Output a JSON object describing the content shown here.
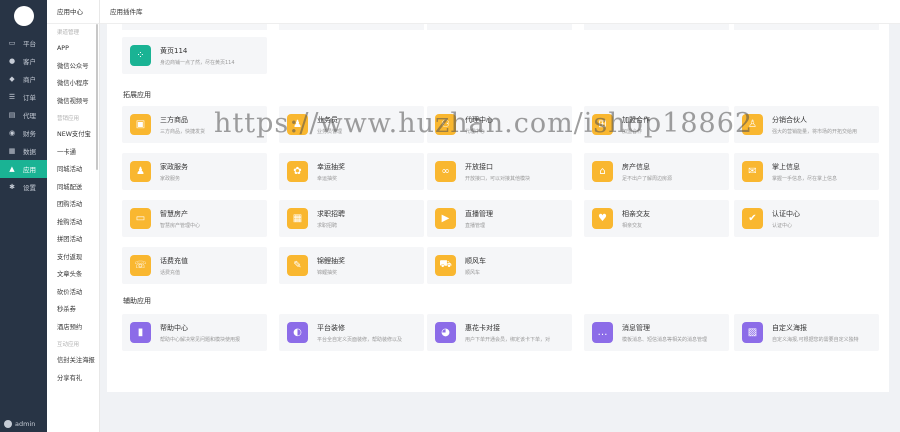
{
  "rail": {
    "items": [
      {
        "label": "平台",
        "icon": "monitor-icon",
        "glyph": "▭"
      },
      {
        "label": "客户",
        "icon": "user-icon",
        "glyph": "●"
      },
      {
        "label": "商户",
        "icon": "users-icon",
        "glyph": "◆"
      },
      {
        "label": "订单",
        "icon": "list-icon",
        "glyph": "☰"
      },
      {
        "label": "代理",
        "icon": "calendar-icon",
        "glyph": "▤"
      },
      {
        "label": "财务",
        "icon": "wallet-icon",
        "glyph": "◉"
      },
      {
        "label": "数据",
        "icon": "chart-icon",
        "glyph": "▦"
      },
      {
        "label": "应用",
        "icon": "app-icon",
        "glyph": "▲"
      },
      {
        "label": "设置",
        "icon": "gear-icon",
        "glyph": "✱"
      }
    ],
    "active_index": 7,
    "user": "admin"
  },
  "submenu": {
    "title": "应用中心",
    "groups": [
      {
        "label": "渠道管理",
        "items": [
          "APP",
          "微信公众号",
          "微信小程序",
          "微信视频号"
        ]
      },
      {
        "label": "营销应用",
        "items": [
          "NEW支付宝",
          "一卡通",
          "同城活动",
          "同城配送",
          "团购活动",
          "抢购活动",
          "拼团活动",
          "支付返现",
          "文章头条",
          "砍价活动",
          "秒杀券",
          "酒店预约"
        ]
      },
      {
        "label": "互动应用",
        "items": [
          "信封关注海报",
          "分享有礼"
        ]
      }
    ]
  },
  "header": {
    "breadcrumb": "应用插件库"
  },
  "watermark": "https://www.huzhan.com/ishop18862",
  "top_card": {
    "name": "黄页114",
    "desc": "身边商铺一点了然，尽在黄页114",
    "icon": "yellowpages-icon",
    "glyph": "⁘"
  },
  "sections": [
    {
      "label": "拓展应用",
      "cards": [
        {
          "name": "三方商品",
          "desc": "三方商品，快捷发货",
          "icon": "goods-icon",
          "glyph": "▣"
        },
        {
          "name": "业务员",
          "desc": "业务员管理",
          "icon": "clerk-icon",
          "glyph": "♟"
        },
        {
          "name": "代理中心",
          "desc": "代理中心",
          "icon": "agent-icon",
          "glyph": "⚇"
        },
        {
          "name": "加盟合作",
          "desc": "加盟合作",
          "icon": "join-icon",
          "glyph": "⊞"
        },
        {
          "name": "分销合伙人",
          "desc": "强大的营销能量，将市场的开拓交给用",
          "icon": "partner-icon",
          "glyph": "♙"
        },
        {
          "name": "家政服务",
          "desc": "家政服务",
          "icon": "housekeeping-icon",
          "glyph": "♟"
        },
        {
          "name": "幸运抽奖",
          "desc": "幸运抽奖",
          "icon": "lottery-icon",
          "glyph": "✿"
        },
        {
          "name": "开放接口",
          "desc": "开放接口，可以对接其他模块",
          "icon": "api-icon",
          "glyph": "∞"
        },
        {
          "name": "房产信息",
          "desc": "足不出户了解周边房源",
          "icon": "house-icon",
          "glyph": "⌂"
        },
        {
          "name": "掌上信息",
          "desc": "掌握一手信息，尽在掌上信息",
          "icon": "message-icon",
          "glyph": "✉"
        },
        {
          "name": "智慧房产",
          "desc": "智慧房产管理中心",
          "icon": "smart-estate-icon",
          "glyph": "▭"
        },
        {
          "name": "求职招聘",
          "desc": "求职招聘",
          "icon": "job-icon",
          "glyph": "▦"
        },
        {
          "name": "直播管理",
          "desc": "直播管理",
          "icon": "live-icon",
          "glyph": "▶"
        },
        {
          "name": "相亲交友",
          "desc": "相亲交友",
          "icon": "dating-icon",
          "glyph": "♥"
        },
        {
          "name": "认证中心",
          "desc": "认证中心",
          "icon": "shield-icon",
          "glyph": "✔"
        },
        {
          "name": "话费充值",
          "desc": "话费充值",
          "icon": "recharge-icon",
          "glyph": "☏"
        },
        {
          "name": "锦鲤抽奖",
          "desc": "锦鲤抽奖",
          "icon": "koi-icon",
          "glyph": "✎"
        },
        {
          "name": "顺风车",
          "desc": "顺风车",
          "icon": "car-icon",
          "glyph": "⛟"
        }
      ]
    },
    {
      "label": "辅助应用",
      "cards": [
        {
          "name": "帮助中心",
          "desc": "帮助中心解决常见问题和模块使用报",
          "icon": "help-icon",
          "glyph": "▮"
        },
        {
          "name": "平台装修",
          "desc": "平台全自定义页面装修，帮助装修以及",
          "icon": "palette-icon",
          "glyph": "◐"
        },
        {
          "name": "惠花卡对接",
          "desc": "用户下单开通会员，绑定该卡下单，对",
          "icon": "card-icon",
          "glyph": "◕"
        },
        {
          "name": "消息管理",
          "desc": "模板消息、短信消息等相关的消息管理",
          "icon": "chat-icon",
          "glyph": "…"
        },
        {
          "name": "自定义海报",
          "desc": "自定义海报,可根据您的需要自定义独特",
          "icon": "poster-icon",
          "glyph": "▨"
        }
      ]
    }
  ],
  "colors": {
    "rail_bg": "#283445",
    "accent": "#1ab394",
    "orange": "#f9b730",
    "purple": "#8c6ce8"
  }
}
